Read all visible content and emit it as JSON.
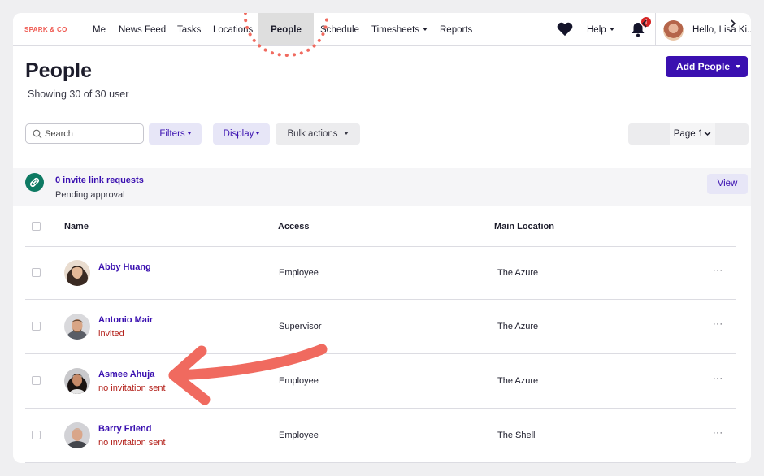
{
  "nav": {
    "brand": "SPARK & CO",
    "items": [
      "Me",
      "News Feed",
      "Tasks",
      "Locations",
      "People",
      "Schedule",
      "Timesheets",
      "Reports"
    ],
    "active": "People",
    "help": "Help",
    "notifications_count": "1",
    "greeting": "Hello, Lisa Ki..."
  },
  "header": {
    "title": "People",
    "subtitle": "Showing 30 of 30 user",
    "add_button": "Add People"
  },
  "toolbar": {
    "search_placeholder": "Search",
    "filters": "Filters",
    "display": "Display",
    "bulk_actions": "Bulk actions",
    "page_label": "Page 1"
  },
  "invite": {
    "title": "0 invite link requests",
    "subtitle": "Pending approval",
    "view": "View"
  },
  "table": {
    "columns": [
      "Name",
      "Access",
      "Main Location"
    ],
    "rows": [
      {
        "name": "Abby Huang",
        "status": "",
        "access": "Employee",
        "location": "The Azure"
      },
      {
        "name": "Antonio Mair",
        "status": "invited",
        "access": "Supervisor",
        "location": "The Azure"
      },
      {
        "name": "Asmee Ahuja",
        "status": "no invitation sent",
        "access": "Employee",
        "location": "The Azure"
      },
      {
        "name": "Barry Friend",
        "status": "no invitation sent",
        "access": "Employee",
        "location": "The Shell"
      }
    ],
    "row_menu": "···"
  },
  "colors": {
    "accent": "#3a10b0",
    "status_red": "#b3201a",
    "annotation": "#f06a5f",
    "link_icon_bg": "#0e7a63"
  }
}
